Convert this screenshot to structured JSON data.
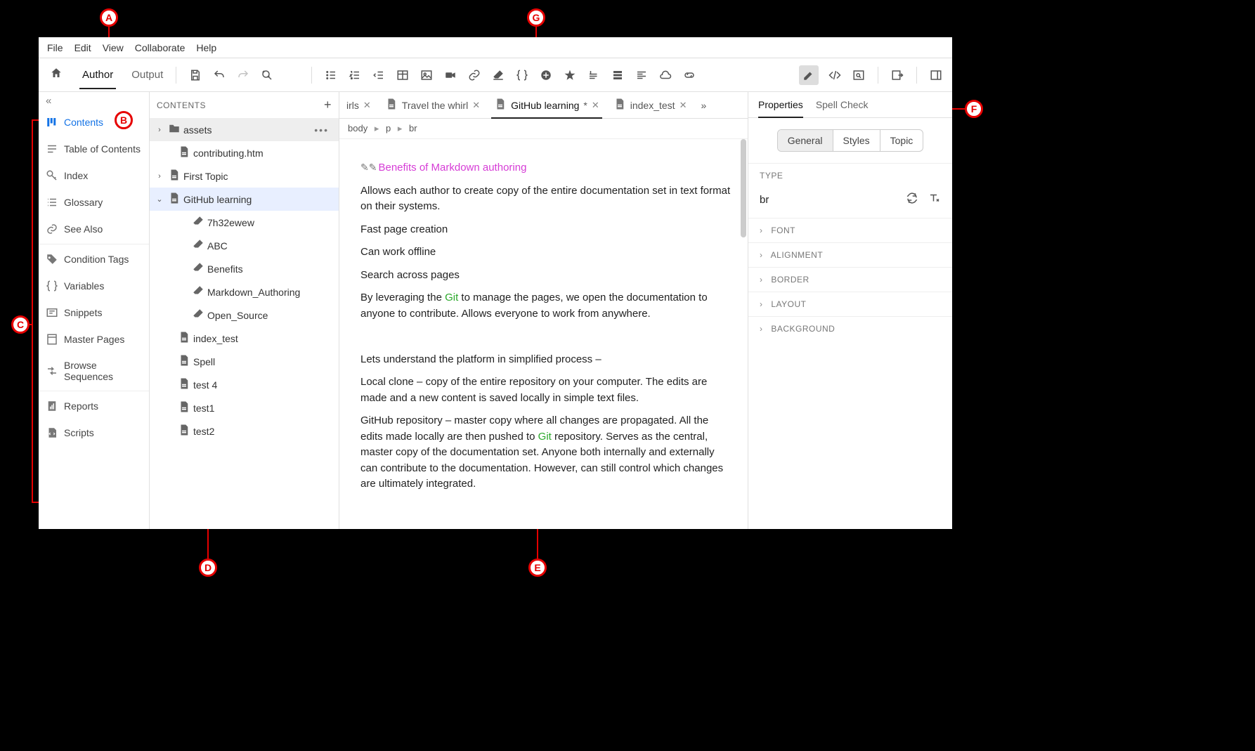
{
  "menu": [
    "File",
    "Edit",
    "View",
    "Collaborate",
    "Help"
  ],
  "modes": {
    "home_icon": "home-icon",
    "author": "Author",
    "output": "Output",
    "active": "author"
  },
  "left_collapse": "«",
  "left_panel": {
    "items": [
      {
        "label": "Contents",
        "icon": "contents-icon",
        "active": true
      },
      {
        "label": "Table of Contents",
        "icon": "toc-icon"
      },
      {
        "label": "Index",
        "icon": "key-icon"
      },
      {
        "label": "Glossary",
        "icon": "glossary-icon"
      },
      {
        "label": "See Also",
        "icon": "link-icon"
      },
      {
        "label": "Condition Tags",
        "icon": "tag-icon",
        "group_start": true
      },
      {
        "label": "Variables",
        "icon": "braces-icon"
      },
      {
        "label": "Snippets",
        "icon": "snippet-icon"
      },
      {
        "label": "Master Pages",
        "icon": "master-icon"
      },
      {
        "label": "Browse Sequences",
        "icon": "sequence-icon"
      },
      {
        "label": "Reports",
        "icon": "report-icon",
        "group_start": true
      },
      {
        "label": "Scripts",
        "icon": "script-icon"
      }
    ]
  },
  "contents_panel": {
    "title": "CONTENTS",
    "tree": [
      {
        "label": "assets",
        "type": "folder",
        "expanded": false,
        "hover": true,
        "menu": true
      },
      {
        "label": "contributing.htm",
        "type": "file",
        "indent": 1
      },
      {
        "label": "First Topic",
        "type": "file",
        "expanded": false,
        "indent": 0,
        "chev": true
      },
      {
        "label": "GitHub learning",
        "type": "file",
        "expanded": true,
        "indent": 0,
        "chev": true,
        "selected": true
      },
      {
        "label": "7h32ewew",
        "type": "md",
        "indent": 2
      },
      {
        "label": "ABC",
        "type": "md",
        "indent": 2
      },
      {
        "label": "Benefits",
        "type": "md",
        "indent": 2
      },
      {
        "label": "Markdown_Authoring",
        "type": "md",
        "indent": 2
      },
      {
        "label": "Open_Source",
        "type": "md",
        "indent": 2
      },
      {
        "label": "index_test",
        "type": "file",
        "indent": 1
      },
      {
        "label": "Spell",
        "type": "file",
        "indent": 1
      },
      {
        "label": "test 4",
        "type": "file",
        "indent": 1
      },
      {
        "label": "test1",
        "type": "file",
        "indent": 1
      },
      {
        "label": "test2",
        "type": "file",
        "indent": 1
      }
    ]
  },
  "doc_tabs": {
    "overflow_left": "irls",
    "tabs": [
      {
        "label": "Travel the whirl",
        "icon": "file-icon"
      },
      {
        "label": "GitHub learning",
        "icon": "file-icon",
        "dirty": "*",
        "active": true
      },
      {
        "label": "index_test",
        "icon": "file-icon"
      }
    ],
    "more": "»"
  },
  "breadcrumb": {
    "parts": [
      "body",
      "p",
      "br"
    ]
  },
  "document": {
    "title": "Benefits of Markdown authoring",
    "p1": "Allows each author to create copy of the entire documentation set in text format on their systems.",
    "p2": "Fast page creation",
    "p3": "Can work offline",
    "p4": "Search across pages",
    "p5a": "By leveraging the ",
    "p5git": "Git",
    "p5b": " to manage the pages, we open the documentation to anyone to contribute. Allows everyone to work from anywhere.",
    "p6": "Lets understand the platform in simplified process –",
    "p7": "Local clone – copy of the entire repository on your computer. The edits are made and a new content is saved locally in simple text files.",
    "p8a": "GitHub repository – master copy where all changes are propagated. All the edits made locally are then pushed to ",
    "p8git": "Git",
    "p8b": " repository. Serves as the central, master copy of the documentation set. Anyone both internally and externally can contribute to the documentation. However, can still control which changes are ultimately integrated."
  },
  "right_panel": {
    "tabs": [
      "Properties",
      "Spell Check"
    ],
    "active_tab": 0,
    "pills": [
      "General",
      "Styles",
      "Topic"
    ],
    "active_pill": 0,
    "type_label": "TYPE",
    "type_value": "br",
    "sections": [
      "FONT",
      "ALIGNMENT",
      "BORDER",
      "LAYOUT",
      "BACKGROUND"
    ]
  },
  "annotations": {
    "A": "A",
    "B": "B",
    "C": "C",
    "D": "D",
    "E": "E",
    "F": "F",
    "G": "G"
  }
}
